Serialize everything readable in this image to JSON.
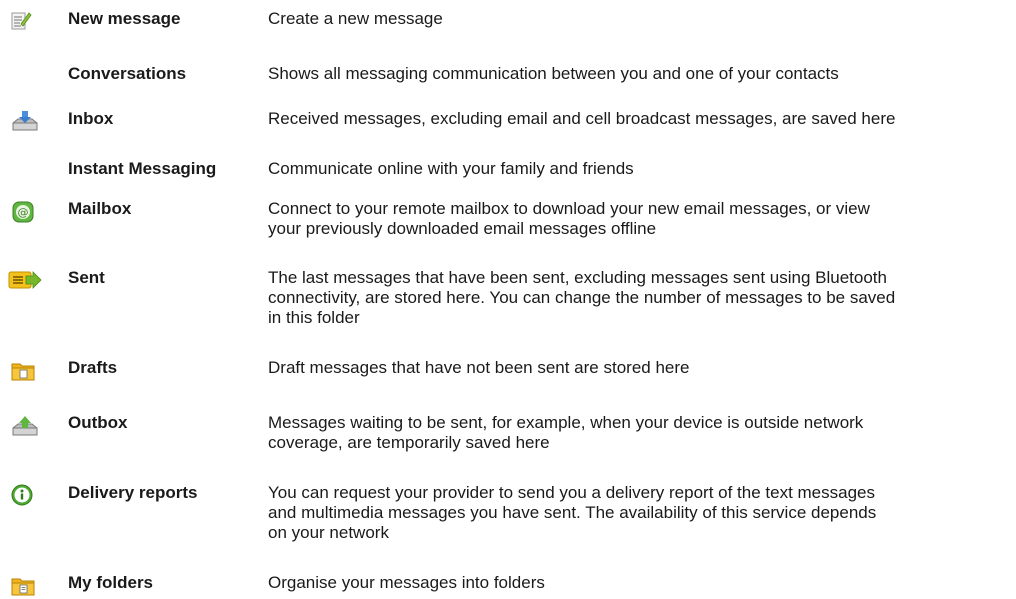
{
  "rows": [
    {
      "icon": "new-message-icon",
      "name": "New message",
      "desc": "Create a new message"
    },
    {
      "icon": "",
      "name": "Conversations",
      "desc": "Shows all messaging communication between you and one of your contacts"
    },
    {
      "icon": "inbox-icon",
      "name": "Inbox",
      "desc": "Received messages, excluding email and cell broadcast messages, are saved here"
    },
    {
      "icon": "",
      "name": "Instant Messaging",
      "desc": "Communicate online with your family and friends"
    },
    {
      "icon": "mailbox-icon",
      "name": "Mailbox",
      "desc": "Connect to your remote mailbox to download your new email messages, or view\nyour previously downloaded email messages offline"
    },
    {
      "icon": "sent-icon",
      "name": "Sent",
      "desc": "The last messages that have been sent, excluding messages sent using Bluetooth\nconnectivity, are stored here. You can change the number of messages to be saved\nin this folder"
    },
    {
      "icon": "drafts-folder-icon",
      "name": "Drafts",
      "desc": "Draft messages that have not been sent are stored here"
    },
    {
      "icon": "outbox-icon",
      "name": "Outbox",
      "desc": "Messages waiting to be sent, for example, when your device is outside network\ncoverage, are temporarily saved here"
    },
    {
      "icon": "info-icon",
      "name": "Delivery reports",
      "desc": "You can request your provider to send you a delivery report of the text messages\nand multimedia messages you have sent. The availability of this service depends\non your network"
    },
    {
      "icon": "my-folders-icon",
      "name": "My folders",
      "desc": "Organise your messages into folders"
    }
  ]
}
